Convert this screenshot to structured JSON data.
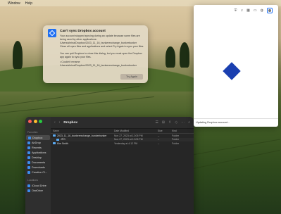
{
  "menubar": {
    "apple": "",
    "items": [
      "Window",
      "Help"
    ]
  },
  "alert": {
    "title": "Can't sync Dropbox account",
    "p1": "Your account stopped syncing during an update because some files are being used by other applications: /Users/shrina/Dropbox/2023_11_16_bunkerexchange_bunkerbunker",
    "p2": "Close all open files and applications and select Try Again to sync your files.",
    "p3": "You can quit Dropbox to close this dialog, but you must open the Dropbox app again to sync your files.",
    "p4": "• Couldn't rename /Users/shrina/Dropbox/2023_11_16_bunkerexchange_bunkerbunker",
    "button": "Try Again"
  },
  "finder": {
    "title": "Dropbox",
    "sidebar": {
      "favorites_label": "Favorites",
      "items": [
        "Dropbox",
        "AirDrop",
        "Recents",
        "Applications",
        "Desktop",
        "Documents",
        "Downloads",
        "Creative Cl..."
      ],
      "locations_label": "Locations",
      "locations": [
        "iCloud Drive",
        "OneDrive"
      ]
    },
    "columns": [
      "Name",
      "Date Modified",
      "Size",
      "Kind"
    ],
    "rows": [
      {
        "name": "2023_11_16_bunkerexchange_bunkerbunker",
        "date": "Nov 27, 2023 at 12:05 PM",
        "size": "--",
        "kind": "Folder"
      },
      {
        "name": "JPG",
        "date": "Nov 27, 2023 at 12:05 PM",
        "size": "--",
        "kind": "Folder"
      },
      {
        "name": "Kim Smith",
        "date": "Yesterday at 4:12 PM",
        "size": "--",
        "kind": "Folder"
      }
    ]
  },
  "popup": {
    "status": "Updating Dropbox account..."
  },
  "colors": {
    "dropbox_blue": "#1f6ff2",
    "dropbox_logo": "#1a3fb0"
  }
}
